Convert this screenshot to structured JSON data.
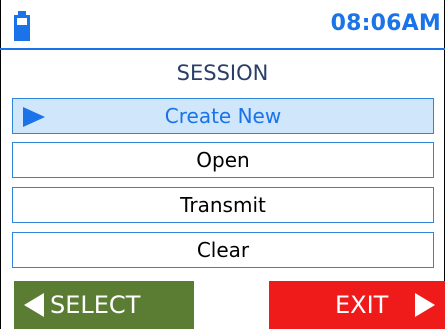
{
  "status_bar": {
    "time": "08:06AM",
    "battery_icon": "battery-icon"
  },
  "screen": {
    "title": "SESSION"
  },
  "menu": {
    "items": [
      {
        "label": "Create New",
        "selected": true
      },
      {
        "label": "Open",
        "selected": false
      },
      {
        "label": "Transmit",
        "selected": false
      },
      {
        "label": "Clear",
        "selected": false
      }
    ]
  },
  "softkeys": {
    "left_label": "SELECT",
    "right_label": "EXIT",
    "left_icon": "triangle-left-icon",
    "right_icon": "triangle-right-icon"
  },
  "colors": {
    "accent": "#1a73e8",
    "selected_bg": "#cfe6fb",
    "left_softkey": "#5a7d33",
    "right_softkey": "#ef1b1b"
  }
}
